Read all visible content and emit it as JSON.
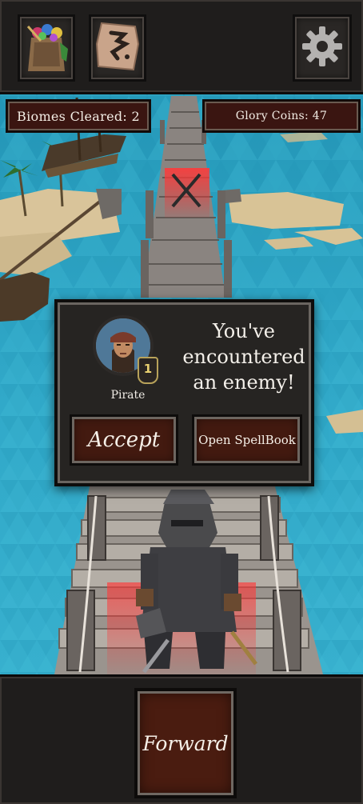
{
  "top_bar": {
    "inventory_icon": "backpack-icon",
    "spellbook_icon": "rune-scroll-icon",
    "settings_icon": "gear-icon"
  },
  "stats": {
    "biomes_cleared": "Biomes Cleared: 2",
    "glory_coins": "Glory Coins: 47"
  },
  "encounter": {
    "enemy_name": "Pirate",
    "enemy_level": "1",
    "message_line1": "You've",
    "message_line2": "encountered",
    "message_line3": "an enemy!",
    "accept_label": "Accept",
    "spellbook_label": "Open SpellBook"
  },
  "bottom_bar": {
    "forward_label": "Forward"
  },
  "colors": {
    "water": "#2fa9c8",
    "button_fill": "#431a10",
    "panel": "#262422"
  }
}
